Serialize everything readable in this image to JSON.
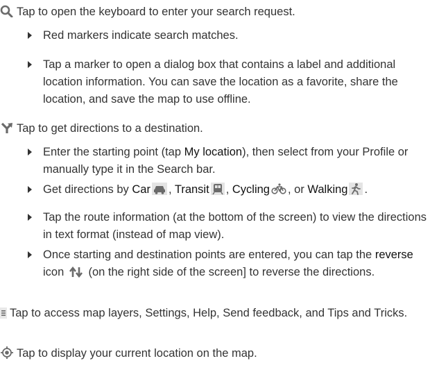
{
  "search": {
    "icon": "search-icon",
    "text": "Tap to open the keyboard to enter your search request.",
    "bullets": [
      "Red markers indicate search matches.",
      "Tap a marker to open a dialog box that contains a label and additional location information. You can save the location as a favorite, share the location, and save the map to use offline."
    ]
  },
  "directions": {
    "icon": "directions-icon",
    "text": "Tap to get directions to a destination.",
    "bullet1": {
      "before": "Enter the starting point (tap ",
      "bold": "My location",
      "after": "), then select from your Profile or manually type it in the Search bar."
    },
    "bullet2": {
      "prefix": "Get directions by ",
      "car": "Car",
      "transit": "Transit",
      "cycling": "Cycling",
      "or": ", or ",
      "walking": "Walking",
      "end": "."
    },
    "bullet3": "Tap the route information (at the bottom of the screen) to view the directions in text format (instead of map view).",
    "bullet4": {
      "before": "Once starting and destination points are entered, you can tap the ",
      "bold": "reverse",
      "middle": " icon ",
      "after": " (on the right side of the screen] to reverse the directions."
    }
  },
  "layers": {
    "icon": "menu-icon",
    "text": "Tap to access map layers, Settings, Help, Send feedback, and Tips and Tricks."
  },
  "location": {
    "icon": "my-location-icon",
    "text": "Tap to display your current location on the map."
  }
}
